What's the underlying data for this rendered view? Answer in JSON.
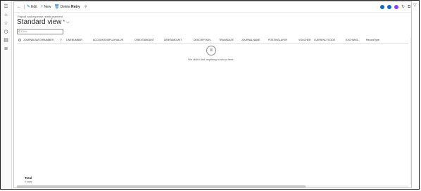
{
  "nav_rail": {
    "icons": [
      "hamburger-icon",
      "home-icon",
      "star-icon",
      "clock-icon",
      "modules-icon",
      "list-icon"
    ]
  },
  "toolbar": {
    "edit_label": "Edit",
    "new_label": "New",
    "delete_label": "Delete",
    "retry_label": "Retry"
  },
  "breadcrumb": "Payroll and expense reimbursement",
  "view": {
    "title": "Standard view",
    "modified_marker": "*"
  },
  "filter": {
    "placeholder": "Filter"
  },
  "grid": {
    "columns": [
      "JOURNALBATCHNUMBER",
      "LINENUMBER",
      "ACCOUNTDISPLAYVALUE",
      "CREDITAMOUNT",
      "DEBITAMOUNT",
      "DESCRIPTION",
      "TRANSDATE",
      "JOURNALNAME",
      "POSTINGLAYER",
      "VOUCHER",
      "CURRENCYCODE",
      "EXCHANG...",
      "RecordType"
    ],
    "empty_message": "We didn't find anything to show here."
  },
  "footer": {
    "total_label": "Total",
    "total_count": "0 rows"
  },
  "colors": {
    "accent": "#0f6cbd",
    "copilot": "#8a3ffc"
  }
}
